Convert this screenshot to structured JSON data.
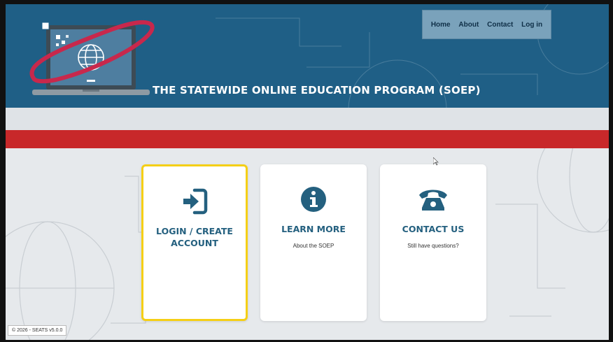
{
  "header": {
    "site_title": "THE STATEWIDE ONLINE EDUCATION PROGRAM (SOEP)"
  },
  "nav": {
    "items": [
      {
        "label": "Home"
      },
      {
        "label": "About"
      },
      {
        "label": "Contact"
      },
      {
        "label": "Log in"
      }
    ]
  },
  "cards": [
    {
      "title_line1": "LOGIN / CREATE",
      "title_line2": "ACCOUNT",
      "subtitle": "",
      "icon": "sign-in-icon",
      "selected": true
    },
    {
      "title_line1": "LEARN MORE",
      "title_line2": "",
      "subtitle": "About the SOEP",
      "icon": "info-circle-icon",
      "selected": false
    },
    {
      "title_line1": "CONTACT US",
      "title_line2": "",
      "subtitle": "Still have questions?",
      "icon": "phone-icon",
      "selected": false
    }
  ],
  "footer": {
    "text": "© 2026 - SEATS v5.0.0"
  },
  "colors": {
    "header_bg": "#1f5f86",
    "nav_bg": "#7aa2bb",
    "red_bar": "#c8282a",
    "accent_text": "#24607f",
    "selected_border": "#f5cf16"
  }
}
